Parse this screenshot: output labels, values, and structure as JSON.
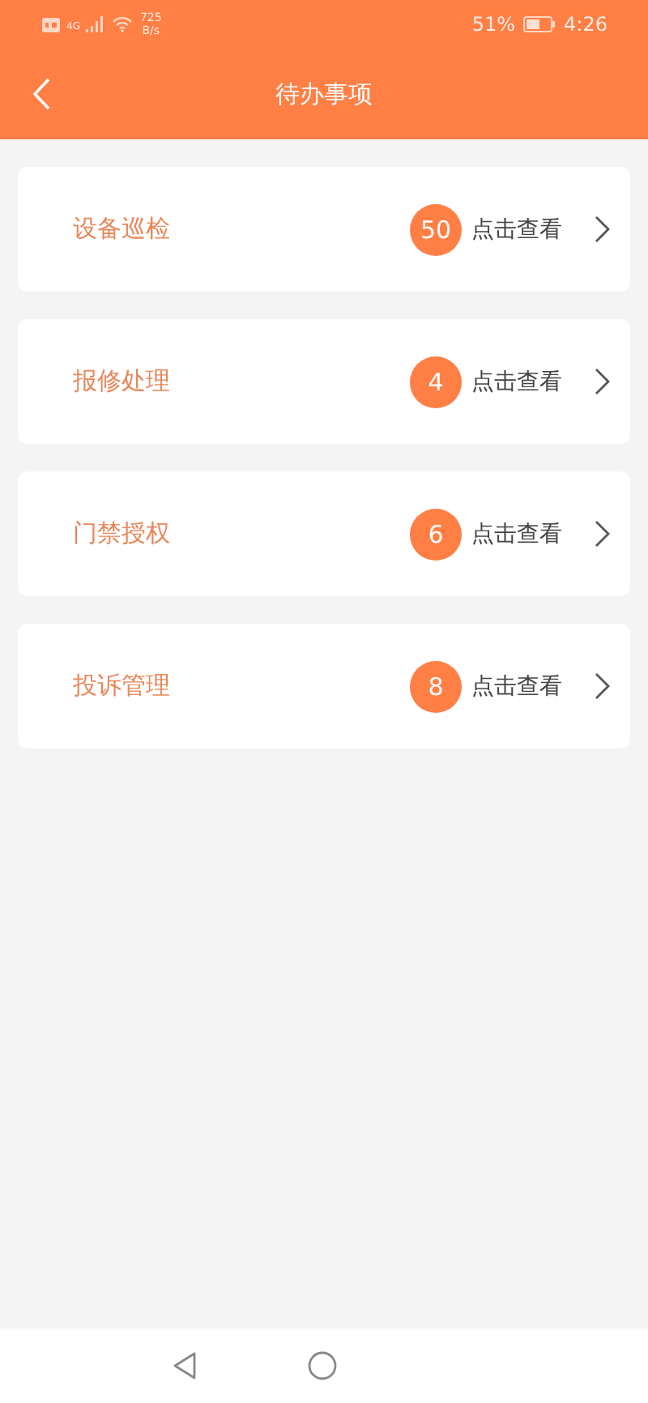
{
  "status_bar": {
    "network_speed_value": "725",
    "network_speed_unit": "B/s",
    "network_type": "4G",
    "battery": "51%",
    "time": "4:26"
  },
  "header": {
    "title": "待办事项"
  },
  "items": [
    {
      "title": "设备巡检",
      "count": "50",
      "action": "点击查看"
    },
    {
      "title": "报修处理",
      "count": "4",
      "action": "点击查看"
    },
    {
      "title": "门禁授权",
      "count": "6",
      "action": "点击查看"
    },
    {
      "title": "投诉管理",
      "count": "8",
      "action": "点击查看"
    }
  ]
}
